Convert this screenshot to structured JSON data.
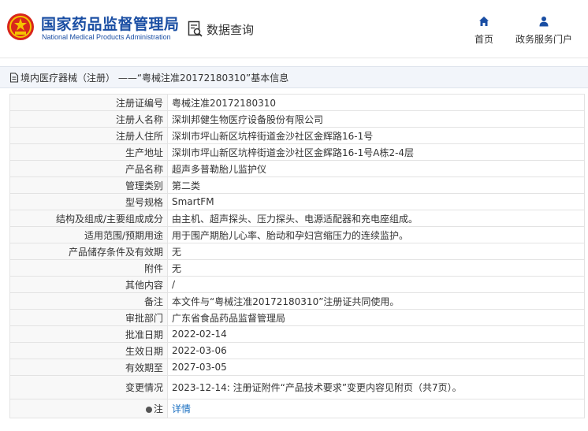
{
  "header": {
    "org_cn": "国家药品监督管理局",
    "org_en": "National Medical Products Administration",
    "query_label": "数据查询",
    "nav": [
      {
        "label": "首页",
        "icon": "home-icon"
      },
      {
        "label": "政务服务门户",
        "icon": "user-icon"
      }
    ]
  },
  "breadcrumb": {
    "text": "境内医疗器械（注册） ——“粤械注准20172180310”基本信息"
  },
  "details": [
    {
      "key": "注册证编号",
      "value": "粤械注准20172180310"
    },
    {
      "key": "注册人名称",
      "value": "深圳邦健生物医疗设备股份有限公司"
    },
    {
      "key": "注册人住所",
      "value": "深圳市坪山新区坑梓街道金沙社区金辉路16-1号"
    },
    {
      "key": "生产地址",
      "value": "深圳市坪山新区坑梓街道金沙社区金辉路16-1号A栋2-4层"
    },
    {
      "key": "产品名称",
      "value": "超声多普勒胎儿监护仪"
    },
    {
      "key": "管理类别",
      "value": "第二类"
    },
    {
      "key": "型号规格",
      "value": "SmartFM"
    },
    {
      "key": "结构及组成/主要组成成分",
      "value": "由主机、超声探头、压力探头、电源适配器和充电座组成。"
    },
    {
      "key": "适用范围/预期用途",
      "value": "用于围产期胎儿心率、胎动和孕妇宫缩压力的连续监护。"
    },
    {
      "key": "产品储存条件及有效期",
      "value": "无"
    },
    {
      "key": "附件",
      "value": "无"
    },
    {
      "key": "其他内容",
      "value": "/"
    },
    {
      "key": "备注",
      "value": "本文件与“粤械注准20172180310”注册证共同使用。"
    },
    {
      "key": "审批部门",
      "value": "广东省食品药品监督管理局"
    },
    {
      "key": "批准日期",
      "value": "2022-02-14"
    },
    {
      "key": "生效日期",
      "value": "2022-03-06"
    },
    {
      "key": "有效期至",
      "value": "2027-03-05"
    },
    {
      "key": "变更情况",
      "value": "2023-12-14: 注册证附件“产品技术要求”变更内容见附页（共7页）。"
    }
  ],
  "note": {
    "key": "注",
    "icon": "pin-icon",
    "link": "详情"
  },
  "colors": {
    "brand_blue": "#1a4ea3",
    "link_blue": "#1a6fc1",
    "emblem_red": "#d8261c"
  }
}
